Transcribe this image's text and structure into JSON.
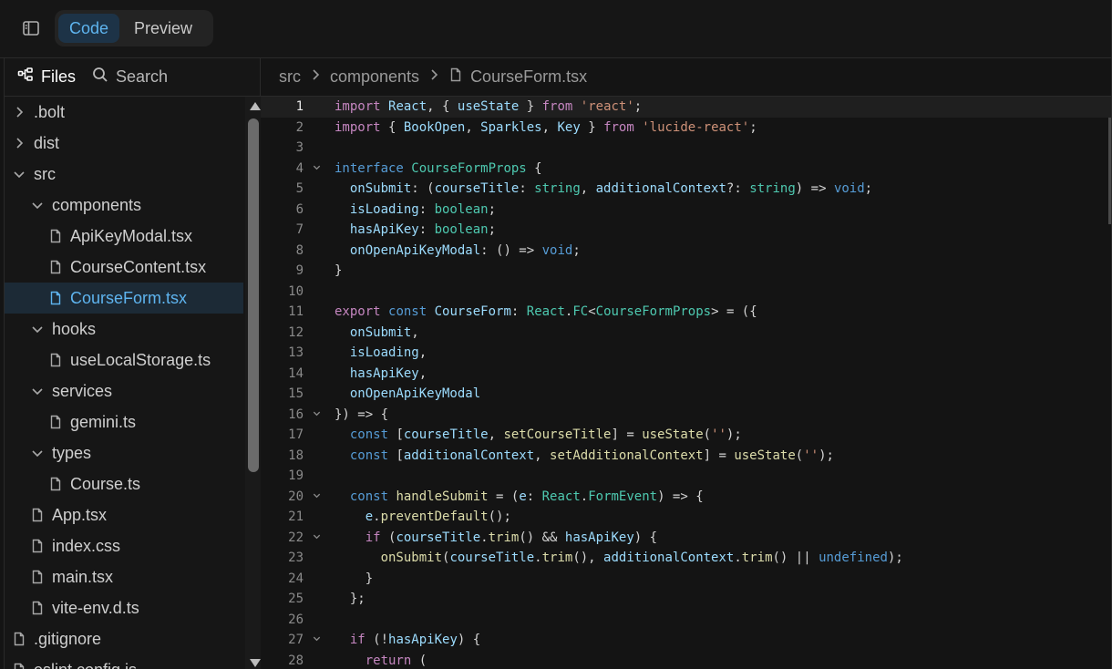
{
  "topbar": {
    "tabs": [
      {
        "label": "Code",
        "active": true
      },
      {
        "label": "Preview",
        "active": false
      }
    ]
  },
  "sidebar": {
    "tabs": [
      {
        "label": "Files",
        "icon": "file-tree-icon",
        "active": true
      },
      {
        "label": "Search",
        "icon": "search-icon",
        "active": false
      }
    ],
    "tree": [
      {
        "label": ".bolt",
        "type": "folder",
        "expanded": false,
        "depth": 0
      },
      {
        "label": "dist",
        "type": "folder",
        "expanded": false,
        "depth": 0
      },
      {
        "label": "src",
        "type": "folder",
        "expanded": true,
        "depth": 0
      },
      {
        "label": "components",
        "type": "folder",
        "expanded": true,
        "depth": 1
      },
      {
        "label": "ApiKeyModal.tsx",
        "type": "file",
        "depth": 2
      },
      {
        "label": "CourseContent.tsx",
        "type": "file",
        "depth": 2
      },
      {
        "label": "CourseForm.tsx",
        "type": "file",
        "depth": 2,
        "selected": true
      },
      {
        "label": "hooks",
        "type": "folder",
        "expanded": true,
        "depth": 1
      },
      {
        "label": "useLocalStorage.ts",
        "type": "file",
        "depth": 2
      },
      {
        "label": "services",
        "type": "folder",
        "expanded": true,
        "depth": 1
      },
      {
        "label": "gemini.ts",
        "type": "file",
        "depth": 2
      },
      {
        "label": "types",
        "type": "folder",
        "expanded": true,
        "depth": 1
      },
      {
        "label": "Course.ts",
        "type": "file",
        "depth": 2
      },
      {
        "label": "App.tsx",
        "type": "file",
        "depth": 1
      },
      {
        "label": "index.css",
        "type": "file",
        "depth": 1
      },
      {
        "label": "main.tsx",
        "type": "file",
        "depth": 1
      },
      {
        "label": "vite-env.d.ts",
        "type": "file",
        "depth": 1
      },
      {
        "label": ".gitignore",
        "type": "file",
        "depth": 0
      },
      {
        "label": "eslint.config.js",
        "type": "file",
        "depth": 0
      }
    ]
  },
  "breadcrumb": {
    "parts": [
      "src",
      "components"
    ],
    "file": "CourseForm.tsx"
  },
  "colors": {
    "accent": "#5eb4ef",
    "keyword": "#c586c0",
    "storage": "#569cd6",
    "type": "#4ec9b0",
    "string": "#ce9178",
    "function": "#dcdcaa",
    "variable": "#9cdcfe",
    "plain": "#d4d4d4"
  },
  "editor": {
    "active_line": 1,
    "lines": [
      {
        "n": "1",
        "fold": false,
        "tokens": [
          [
            "kw",
            "import"
          ],
          [
            "p",
            " "
          ],
          [
            "v",
            "React"
          ],
          [
            "p",
            ", { "
          ],
          [
            "v",
            "useState"
          ],
          [
            "p",
            " } "
          ],
          [
            "kw",
            "from"
          ],
          [
            "p",
            " "
          ],
          [
            "s",
            "'react'"
          ],
          [
            "p",
            ";"
          ]
        ]
      },
      {
        "n": "2",
        "fold": false,
        "tokens": [
          [
            "kw",
            "import"
          ],
          [
            "p",
            " { "
          ],
          [
            "v",
            "BookOpen"
          ],
          [
            "p",
            ", "
          ],
          [
            "v",
            "Sparkles"
          ],
          [
            "p",
            ", "
          ],
          [
            "v",
            "Key"
          ],
          [
            "p",
            " } "
          ],
          [
            "kw",
            "from"
          ],
          [
            "p",
            " "
          ],
          [
            "s",
            "'lucide-react'"
          ],
          [
            "p",
            ";"
          ]
        ]
      },
      {
        "n": "3",
        "fold": false,
        "tokens": []
      },
      {
        "n": "4",
        "fold": true,
        "tokens": [
          [
            "st",
            "interface"
          ],
          [
            "p",
            " "
          ],
          [
            "t",
            "CourseFormProps"
          ],
          [
            "p",
            " {"
          ]
        ]
      },
      {
        "n": "5",
        "fold": false,
        "tokens": [
          [
            "p",
            "  "
          ],
          [
            "v",
            "onSubmit"
          ],
          [
            "p",
            ": ("
          ],
          [
            "v",
            "courseTitle"
          ],
          [
            "p",
            ": "
          ],
          [
            "t",
            "string"
          ],
          [
            "p",
            ", "
          ],
          [
            "v",
            "additionalContext"
          ],
          [
            "p",
            "?: "
          ],
          [
            "t",
            "string"
          ],
          [
            "p",
            ") => "
          ],
          [
            "st",
            "void"
          ],
          [
            "p",
            ";"
          ]
        ]
      },
      {
        "n": "6",
        "fold": false,
        "tokens": [
          [
            "p",
            "  "
          ],
          [
            "v",
            "isLoading"
          ],
          [
            "p",
            ": "
          ],
          [
            "t",
            "boolean"
          ],
          [
            "p",
            ";"
          ]
        ]
      },
      {
        "n": "7",
        "fold": false,
        "tokens": [
          [
            "p",
            "  "
          ],
          [
            "v",
            "hasApiKey"
          ],
          [
            "p",
            ": "
          ],
          [
            "t",
            "boolean"
          ],
          [
            "p",
            ";"
          ]
        ]
      },
      {
        "n": "8",
        "fold": false,
        "tokens": [
          [
            "p",
            "  "
          ],
          [
            "v",
            "onOpenApiKeyModal"
          ],
          [
            "p",
            ": () => "
          ],
          [
            "st",
            "void"
          ],
          [
            "p",
            ";"
          ]
        ]
      },
      {
        "n": "9",
        "fold": false,
        "tokens": [
          [
            "p",
            "}"
          ]
        ]
      },
      {
        "n": "10",
        "fold": false,
        "tokens": []
      },
      {
        "n": "11",
        "fold": false,
        "tokens": [
          [
            "kw",
            "export"
          ],
          [
            "p",
            " "
          ],
          [
            "st",
            "const"
          ],
          [
            "p",
            " "
          ],
          [
            "v",
            "CourseForm"
          ],
          [
            "p",
            ": "
          ],
          [
            "t",
            "React"
          ],
          [
            "p",
            "."
          ],
          [
            "t",
            "FC"
          ],
          [
            "p",
            "<"
          ],
          [
            "t",
            "CourseFormProps"
          ],
          [
            "p",
            "> = ({"
          ]
        ]
      },
      {
        "n": "12",
        "fold": false,
        "tokens": [
          [
            "p",
            "  "
          ],
          [
            "v",
            "onSubmit"
          ],
          [
            "p",
            ","
          ]
        ]
      },
      {
        "n": "13",
        "fold": false,
        "tokens": [
          [
            "p",
            "  "
          ],
          [
            "v",
            "isLoading"
          ],
          [
            "p",
            ","
          ]
        ]
      },
      {
        "n": "14",
        "fold": false,
        "tokens": [
          [
            "p",
            "  "
          ],
          [
            "v",
            "hasApiKey"
          ],
          [
            "p",
            ","
          ]
        ]
      },
      {
        "n": "15",
        "fold": false,
        "tokens": [
          [
            "p",
            "  "
          ],
          [
            "v",
            "onOpenApiKeyModal"
          ]
        ]
      },
      {
        "n": "16",
        "fold": true,
        "tokens": [
          [
            "p",
            "}) => {"
          ]
        ]
      },
      {
        "n": "17",
        "fold": false,
        "tokens": [
          [
            "p",
            "  "
          ],
          [
            "st",
            "const"
          ],
          [
            "p",
            " ["
          ],
          [
            "v",
            "courseTitle"
          ],
          [
            "p",
            ", "
          ],
          [
            "f",
            "setCourseTitle"
          ],
          [
            "p",
            "] = "
          ],
          [
            "f",
            "useState"
          ],
          [
            "p",
            "("
          ],
          [
            "s",
            "''"
          ],
          [
            "p",
            ");"
          ]
        ]
      },
      {
        "n": "18",
        "fold": false,
        "tokens": [
          [
            "p",
            "  "
          ],
          [
            "st",
            "const"
          ],
          [
            "p",
            " ["
          ],
          [
            "v",
            "additionalContext"
          ],
          [
            "p",
            ", "
          ],
          [
            "f",
            "setAdditionalContext"
          ],
          [
            "p",
            "] = "
          ],
          [
            "f",
            "useState"
          ],
          [
            "p",
            "("
          ],
          [
            "s",
            "''"
          ],
          [
            "p",
            ");"
          ]
        ]
      },
      {
        "n": "19",
        "fold": false,
        "tokens": []
      },
      {
        "n": "20",
        "fold": true,
        "tokens": [
          [
            "p",
            "  "
          ],
          [
            "st",
            "const"
          ],
          [
            "p",
            " "
          ],
          [
            "f",
            "handleSubmit"
          ],
          [
            "p",
            " = ("
          ],
          [
            "v",
            "e"
          ],
          [
            "p",
            ": "
          ],
          [
            "t",
            "React"
          ],
          [
            "p",
            "."
          ],
          [
            "t",
            "FormEvent"
          ],
          [
            "p",
            ") => {"
          ]
        ]
      },
      {
        "n": "21",
        "fold": false,
        "tokens": [
          [
            "p",
            "    "
          ],
          [
            "v",
            "e"
          ],
          [
            "p",
            "."
          ],
          [
            "f",
            "preventDefault"
          ],
          [
            "p",
            "();"
          ]
        ]
      },
      {
        "n": "22",
        "fold": true,
        "tokens": [
          [
            "p",
            "    "
          ],
          [
            "kw",
            "if"
          ],
          [
            "p",
            " ("
          ],
          [
            "v",
            "courseTitle"
          ],
          [
            "p",
            "."
          ],
          [
            "f",
            "trim"
          ],
          [
            "p",
            "() && "
          ],
          [
            "v",
            "hasApiKey"
          ],
          [
            "p",
            ") {"
          ]
        ]
      },
      {
        "n": "23",
        "fold": false,
        "tokens": [
          [
            "p",
            "      "
          ],
          [
            "f",
            "onSubmit"
          ],
          [
            "p",
            "("
          ],
          [
            "v",
            "courseTitle"
          ],
          [
            "p",
            "."
          ],
          [
            "f",
            "trim"
          ],
          [
            "p",
            "(), "
          ],
          [
            "v",
            "additionalContext"
          ],
          [
            "p",
            "."
          ],
          [
            "f",
            "trim"
          ],
          [
            "p",
            "() || "
          ],
          [
            "st",
            "undefined"
          ],
          [
            "p",
            ");"
          ]
        ]
      },
      {
        "n": "24",
        "fold": false,
        "tokens": [
          [
            "p",
            "    }"
          ]
        ]
      },
      {
        "n": "25",
        "fold": false,
        "tokens": [
          [
            "p",
            "  };"
          ]
        ]
      },
      {
        "n": "26",
        "fold": false,
        "tokens": []
      },
      {
        "n": "27",
        "fold": true,
        "tokens": [
          [
            "p",
            "  "
          ],
          [
            "kw",
            "if"
          ],
          [
            "p",
            " (!"
          ],
          [
            "v",
            "hasApiKey"
          ],
          [
            "p",
            ") {"
          ]
        ]
      },
      {
        "n": "28",
        "fold": false,
        "tokens": [
          [
            "p",
            "    "
          ],
          [
            "kw",
            "return"
          ],
          [
            "p",
            " ("
          ]
        ]
      }
    ]
  }
}
